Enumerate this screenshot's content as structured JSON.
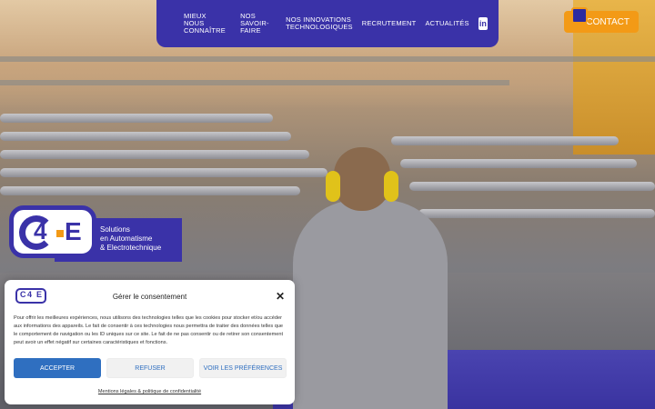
{
  "nav": {
    "items": [
      {
        "label": "MIEUX\nNOUS CONNAÎTRE"
      },
      {
        "label": "NOS\nSAVOIR-FAIRE"
      },
      {
        "label": "NOS INNOVATIONS\nTECHNOLOGIQUES"
      },
      {
        "label": "RECRUTEMENT"
      },
      {
        "label": "ACTUALITÉS"
      }
    ],
    "linkedin_icon": "linkedin-icon"
  },
  "contact": {
    "label": "CONTACT",
    "icon": "contact-icon"
  },
  "brand": {
    "logo": "C4E",
    "tagline_line1": "Solutions",
    "tagline_line2": "en Automatisme",
    "tagline_line3": "& Electrotechnique"
  },
  "consent": {
    "title": "Gérer le consentement",
    "body": "Pour offrir les meilleures expériences, nous utilisons des technologies telles que les cookies pour stocker et/ou accéder aux informations des appareils. Le fait de consentir à ces technologies nous permettra de traiter des données telles que le comportement de navigation ou les ID uniques sur ce site. Le fait de ne pas consentir ou de retirer son consentement peut avoir un effet négatif sur certaines caractéristiques et fonctions.",
    "accept": "ACCEPTER",
    "refuse": "REFUSER",
    "prefs": "VOIR LES PRÉFÉRENCES",
    "legal_link": "Mentions légales & politique de confidentialité"
  },
  "colors": {
    "brand_purple": "#3a32a8",
    "accent_orange": "#f39a16",
    "accept_blue": "#2f6fc0"
  }
}
